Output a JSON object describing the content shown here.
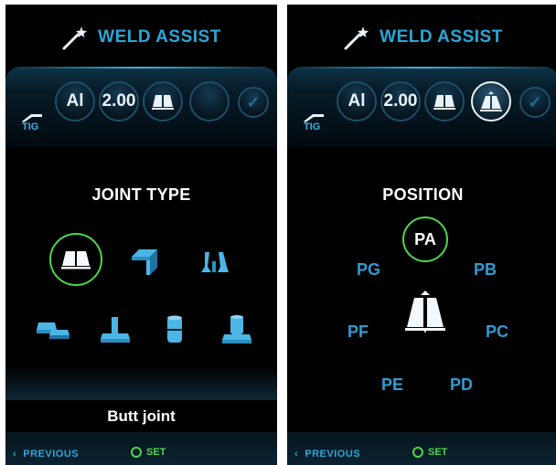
{
  "panels": {
    "left": {
      "title": "WELD ASSIST",
      "process": "TIG",
      "material": "Al",
      "thickness": "2.00",
      "heading": "JOINT TYPE",
      "selected_joint_name": "Butt joint",
      "joints_row1": [
        "butt-joint-icon",
        "corner-joint-icon",
        "t-joint-icon"
      ],
      "joints_row2": [
        "lap-joint-icon",
        "fillet-joint-icon",
        "pipe-joint-icon",
        "pipe-flange-joint-icon"
      ],
      "footer": {
        "prev": "PREVIOUS",
        "set": "SET"
      }
    },
    "right": {
      "title": "WELD ASSIST",
      "process": "TIG",
      "material": "Al",
      "thickness": "2.00",
      "heading": "POSITION",
      "positions": {
        "pa": "PA",
        "pb": "PB",
        "pc": "PC",
        "pd": "PD",
        "pe": "PE",
        "pf": "PF",
        "pg": "PG"
      },
      "footer": {
        "prev": "PREVIOUS",
        "set": "SET"
      }
    }
  },
  "colors": {
    "accent": "#2aa7d8",
    "select_ring": "#4ed64a",
    "background": "#000000"
  }
}
